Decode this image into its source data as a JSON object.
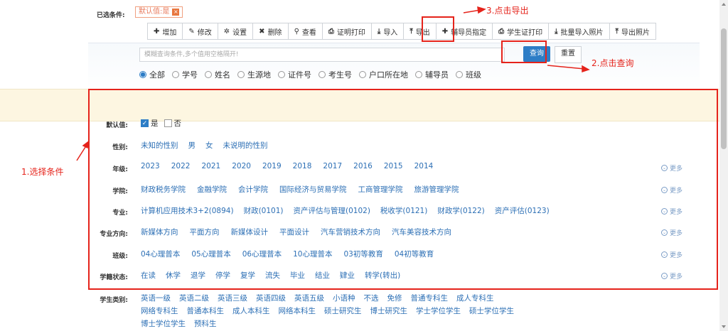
{
  "toolbar": {
    "buttons": [
      {
        "label": "增加",
        "icon": "plus-icon",
        "glyph": "✚"
      },
      {
        "label": "修改",
        "icon": "edit-icon",
        "glyph": "✎"
      },
      {
        "label": "设置",
        "icon": "gear-icon",
        "glyph": "✲"
      },
      {
        "label": "删除",
        "icon": "delete-icon",
        "glyph": "✖"
      },
      {
        "label": "查看",
        "icon": "search-icon",
        "glyph": "⚲"
      },
      {
        "label": "证明打印",
        "icon": "print-icon",
        "glyph": "⎙"
      },
      {
        "label": "导入",
        "icon": "import-icon",
        "glyph": "⤓"
      },
      {
        "label": "导出",
        "icon": "export-icon",
        "glyph": "⤒"
      },
      {
        "label": "辅导员指定",
        "icon": "plus-icon",
        "glyph": "✚"
      },
      {
        "label": "学生证打印",
        "icon": "print-icon",
        "glyph": "⎙"
      },
      {
        "label": "批量导入照片",
        "icon": "import-icon",
        "glyph": "⤓"
      },
      {
        "label": "导出照片",
        "icon": "export-icon",
        "glyph": "⤒"
      }
    ]
  },
  "search": {
    "placeholder": "模糊查询条件,多个值用空格隔开!",
    "query_label": "查询",
    "reset_label": "重置",
    "radio_options": [
      "全部",
      "学号",
      "姓名",
      "生源地",
      "证件号",
      "考生号",
      "户口所在地",
      "辅导员",
      "班级"
    ],
    "selected_radio": "全部"
  },
  "selected_conditions": {
    "label": "已选条件:",
    "tag": "默认值:是",
    "close_glyph": "×"
  },
  "filters": {
    "default_value": {
      "label": "默认值:",
      "yes": "是",
      "no": "否",
      "yes_checked": true
    },
    "gender": {
      "label": "性别:",
      "items": [
        "未知的性别",
        "男",
        "女",
        "未说明的性别"
      ]
    },
    "grade": {
      "label": "年级:",
      "items": [
        "2023",
        "2022",
        "2021",
        "2020",
        "2019",
        "2018",
        "2017",
        "2016",
        "2015",
        "2014"
      ]
    },
    "college": {
      "label": "学院:",
      "items": [
        "财政税务学院",
        "金融学院",
        "会计学院",
        "国际经济与贸易学院",
        "工商管理学院",
        "旅游管理学院"
      ]
    },
    "major": {
      "label": "专业:",
      "items": [
        "计算机应用技术3+2(0894)",
        "财政(0101)",
        "资产评估与管理(0102)",
        "税收学(0121)",
        "财政学(0122)",
        "资产评估(0123)"
      ]
    },
    "direction": {
      "label": "专业方向:",
      "items": [
        "新媒体方向",
        "平面方向",
        "新媒体设计",
        "平面设计",
        "汽车营销技术方向",
        "汽车美容技术方向"
      ]
    },
    "class": {
      "label": "班级:",
      "items": [
        "04心理普本",
        "05心理普本",
        "06心理普本",
        "10心理普本",
        "03初等教育",
        "04初等教育"
      ]
    },
    "status": {
      "label": "学籍状态:",
      "items": [
        "在读",
        "休学",
        "退学",
        "停学",
        "复学",
        "流失",
        "毕业",
        "结业",
        "肄业",
        "转学(转出)"
      ]
    },
    "category": {
      "label": "学生类别:",
      "line1": [
        "英语一级",
        "英语二级",
        "英语三级",
        "英语四级",
        "英语五级",
        "小语种",
        "不选",
        "免修",
        "普通专科生",
        "成人专科生"
      ],
      "line2": [
        "网络专科生",
        "普通本科生",
        "成人本科生",
        "网络本科生",
        "硕士研究生",
        "博士研究生",
        "学士学位学生",
        "硕士学位学生"
      ],
      "line3": [
        "博士学位学生",
        "预科生"
      ]
    },
    "more_label": "更多"
  },
  "annotations": {
    "step1": "1.选择条件",
    "step2": "2.点击查询",
    "step3": "3.点击导出"
  },
  "colors": {
    "accent": "#2d7dc6",
    "link": "#2c6fb5",
    "annotation_red": "#e5231b",
    "selected_strip": "#fdf6e1"
  }
}
